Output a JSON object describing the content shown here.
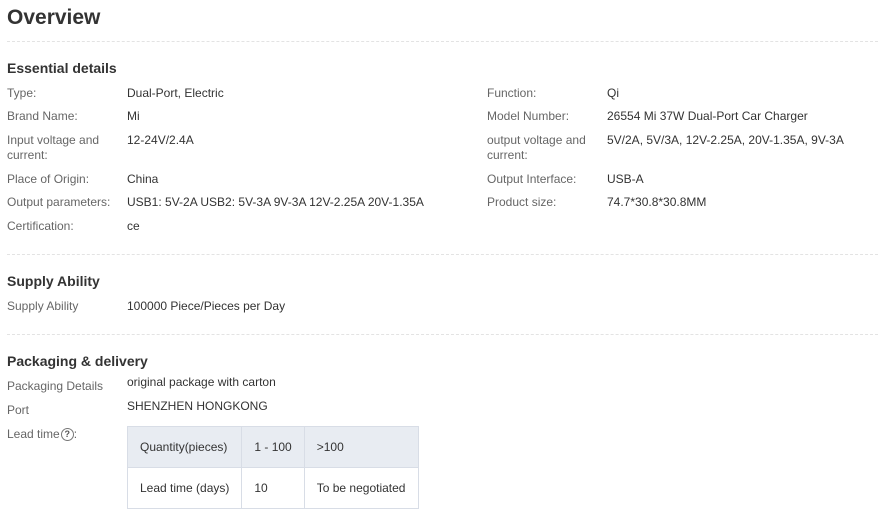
{
  "page_title": "Overview",
  "essential": {
    "title": "Essential details",
    "left": [
      {
        "label": "Type:",
        "value": "Dual-Port, Electric"
      },
      {
        "label": "Brand Name:",
        "value": "Mi"
      },
      {
        "label": "Input voltage and current:",
        "value": "12-24V/2.4A"
      },
      {
        "label": "Place of Origin:",
        "value": "China"
      },
      {
        "label": "Output parameters:",
        "value": "USB1: 5V-2A USB2: 5V-3A 9V-3A 12V-2.25A 20V-1.35A"
      },
      {
        "label": "Certification:",
        "value": "ce"
      }
    ],
    "right": [
      {
        "label": "Function:",
        "value": "Qi"
      },
      {
        "label": "Model Number:",
        "value": "26554 Mi 37W Dual-Port Car Charger"
      },
      {
        "label": "output voltage and current:",
        "value": "5V/2A, 5V/3A, 12V-2.25A, 20V-1.35A, 9V-3A"
      },
      {
        "label": "Output Interface:",
        "value": "USB-A"
      },
      {
        "label": "Product size:",
        "value": "74.7*30.8*30.8MM"
      }
    ]
  },
  "supply": {
    "title": "Supply Ability",
    "label": "Supply Ability",
    "value": "100000 Piece/Pieces per Day"
  },
  "packaging": {
    "title": "Packaging & delivery",
    "details_label": "Packaging Details",
    "details_value": "original package with carton",
    "port_label": "Port",
    "port_value": "SHENZHEN HONGKONG",
    "lead_label": "Lead time",
    "help_icon": "?",
    "table": {
      "header": [
        "Quantity(pieces)",
        "1 - 100",
        ">100"
      ],
      "row": [
        "Lead time (days)",
        "10",
        "To be negotiated"
      ]
    }
  }
}
